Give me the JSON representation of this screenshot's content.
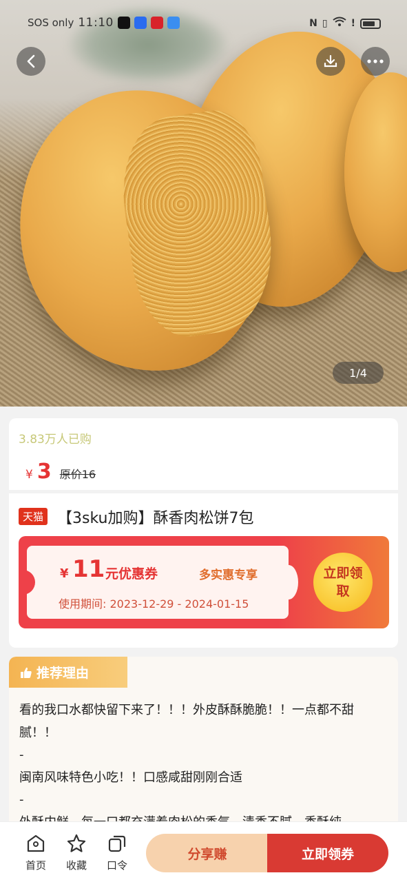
{
  "status_bar": {
    "left_text": "SOS only",
    "time": "11:10",
    "right_text": "N"
  },
  "hero": {
    "pager": "1/4",
    "icons": [
      "back-icon",
      "download-icon",
      "more-icon"
    ]
  },
  "product": {
    "sold_count": "3.83万人已购",
    "currency": "¥",
    "price": "3",
    "original_price": "原价16",
    "badge": "天猫",
    "title": "【3sku加购】酥香肉松饼7包"
  },
  "coupon": {
    "currency": "¥",
    "amount": "11",
    "label": "元优惠券",
    "exclusive": "多实惠专享",
    "period": "使用期间: 2023-12-29 - 2024-01-15",
    "claim_label": "立即领取",
    "colors": {
      "accent": "#ee4149",
      "button": "#f9c733"
    }
  },
  "recommend": {
    "tag": "推荐理由",
    "lines": [
      "看的我口水都快留下来了！！！外皮酥酥脆脆！！一点都不甜腻！！",
      "-",
      "闽南风味特色小吃！！口感咸甜刚刚合适",
      "-",
      "外酥内鲜，每一口都充满着肉松的香气，清香不腻，香酥纯"
    ]
  },
  "bottom_nav": {
    "home": "首页",
    "favorite": "收藏",
    "code": "口令",
    "share_button": "分享赚",
    "claim_button": "立即领券"
  }
}
